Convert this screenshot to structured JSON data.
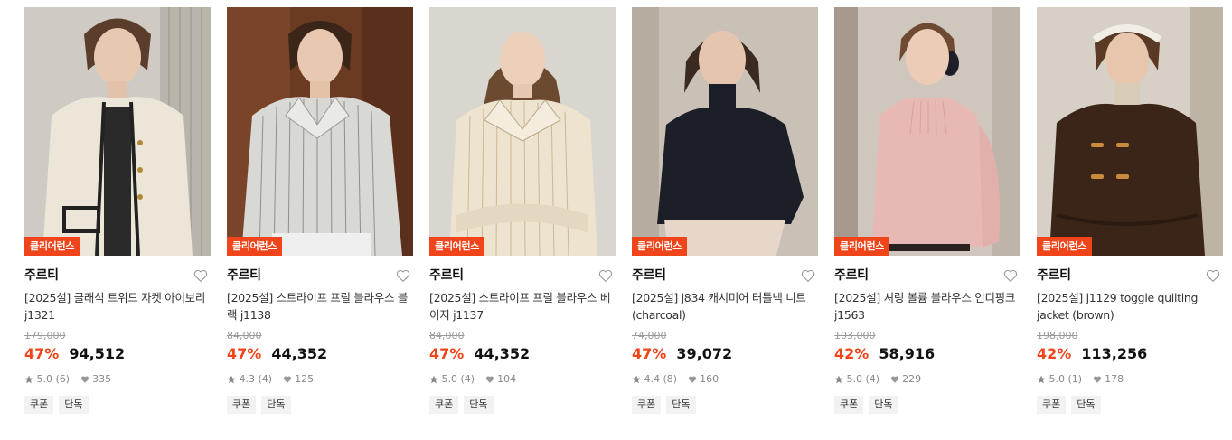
{
  "accent_color": "#f0441a",
  "products": [
    {
      "badge": "클리어런스",
      "brand": "주르티",
      "title": "[2025설] 클래식 트위드 자켓 아이보리 j1321",
      "original_price": "179,000",
      "discount": "47%",
      "price": "94,512",
      "rating": "5.0 (6)",
      "likes": "335",
      "tags": [
        "쿠폰",
        "단독"
      ],
      "wishlist_icon": "heart-outline-icon"
    },
    {
      "badge": "클리어런스",
      "brand": "주르티",
      "title": "[2025설] 스트라이프 프릴 블라우스 블랙 j1138",
      "original_price": "84,000",
      "discount": "47%",
      "price": "44,352",
      "rating": "4.3 (4)",
      "likes": "125",
      "tags": [
        "쿠폰",
        "단독"
      ],
      "wishlist_icon": "heart-outline-icon"
    },
    {
      "badge": "클리어런스",
      "brand": "주르티",
      "title": "[2025설] 스트라이프 프릴 블라우스 베이지 j1137",
      "original_price": "84,000",
      "discount": "47%",
      "price": "44,352",
      "rating": "5.0 (4)",
      "likes": "104",
      "tags": [
        "쿠폰",
        "단독"
      ],
      "wishlist_icon": "heart-outline-icon"
    },
    {
      "badge": "클리어런스",
      "brand": "주르티",
      "title": "[2025설] j834 캐시미어 터틀넥 니트 (charcoal)",
      "original_price": "74,000",
      "discount": "47%",
      "price": "39,072",
      "rating": "4.4 (8)",
      "likes": "160",
      "tags": [
        "쿠폰",
        "단독"
      ],
      "wishlist_icon": "heart-outline-icon"
    },
    {
      "badge": "클리어런스",
      "brand": "주르티",
      "title": "[2025설] 셔링 볼륨 블라우스 인디핑크 j1563",
      "original_price": "103,000",
      "discount": "42%",
      "price": "58,916",
      "rating": "5.0 (4)",
      "likes": "229",
      "tags": [
        "쿠폰",
        "단독"
      ],
      "wishlist_icon": "heart-outline-icon"
    },
    {
      "badge": "클리어런스",
      "brand": "주르티",
      "title": "[2025설] j1129 toggle quilting jacket (brown)",
      "original_price": "198,000",
      "discount": "42%",
      "price": "113,256",
      "rating": "5.0 (1)",
      "likes": "178",
      "tags": [
        "쿠폰",
        "단독"
      ],
      "wishlist_icon": "heart-outline-icon"
    }
  ]
}
